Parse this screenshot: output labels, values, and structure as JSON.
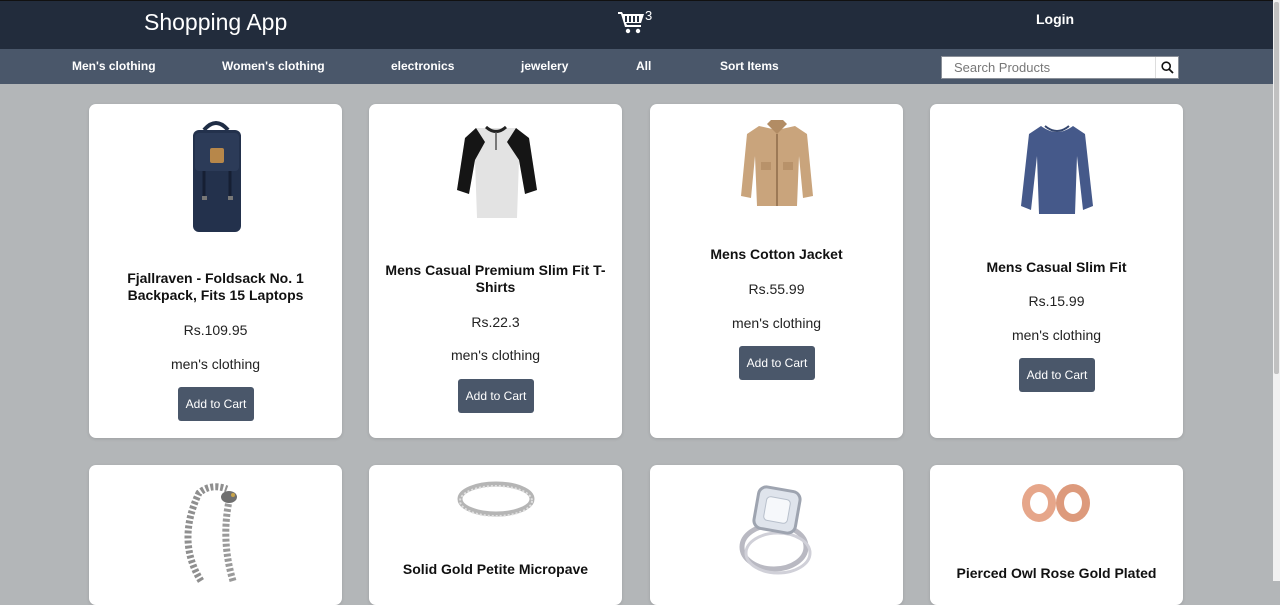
{
  "header": {
    "title": "Shopping App",
    "cart_count": "3",
    "login_label": "Login"
  },
  "nav": {
    "items": [
      "Men's clothing",
      "Women's clothing",
      "electronics",
      "jewelery",
      "All",
      "Sort Items"
    ]
  },
  "search": {
    "placeholder": "Search Products",
    "value": ""
  },
  "products": [
    {
      "title": "Fjallraven - Foldsack No. 1 Backpack, Fits 15 Laptops",
      "price": "Rs.109.95",
      "category": "men's clothing",
      "button": "Add to Cart",
      "image": "backpack"
    },
    {
      "title": "Mens Casual Premium Slim Fit T-Shirts",
      "price": "Rs.22.3",
      "category": "men's clothing",
      "button": "Add to Cart",
      "image": "raglan-tshirt"
    },
    {
      "title": "Mens Cotton Jacket",
      "price": "Rs.55.99",
      "category": "men's clothing",
      "button": "Add to Cart",
      "image": "jacket"
    },
    {
      "title": "Mens Casual Slim Fit",
      "price": "Rs.15.99",
      "category": "men's clothing",
      "button": "Add to Cart",
      "image": "longsleeve-shirt"
    },
    {
      "title": "",
      "image": "dragon-bracelet"
    },
    {
      "title": "Solid Gold Petite Micropave",
      "image": "silver-ring"
    },
    {
      "title": "",
      "image": "diamond-ring"
    },
    {
      "title": "Pierced Owl Rose Gold Plated",
      "image": "rose-gold-plugs"
    }
  ],
  "colors": {
    "header_bg": "#222c3c",
    "nav_bg": "#4a576a",
    "page_bg": "#b3b6b8",
    "button_bg": "#4a576a"
  }
}
